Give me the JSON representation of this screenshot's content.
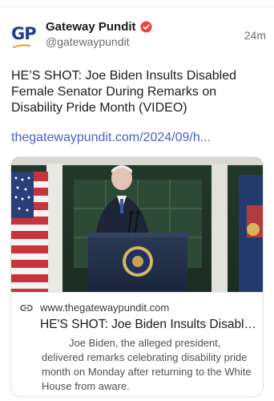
{
  "account": {
    "logo_text": "GP",
    "name": "Gateway Pundit",
    "handle": "@gatewaypundit",
    "time": "24m"
  },
  "post": {
    "text": "HE’S SHOT: Joe Biden Insults Disabled Female Senator During Remarks on Disability Pride Month (VIDEO)",
    "link": "thegatewaypundit.com/2024/09/h..."
  },
  "card": {
    "domain": "www.thegatewaypundit.com",
    "title": "HE'S SHOT: Joe Biden Insults Disable...",
    "description": "Joe Biden, the alleged president, delivered remarks celebrating disability pride month on Monday after returning to the White House from aware."
  },
  "icons": {
    "verified": "verified-badge-icon",
    "link": "link-chain-icon"
  },
  "colors": {
    "brand_blue": "#1f3e8c",
    "brand_orange": "#f29b21",
    "verified_red": "#e8453c",
    "link_blue": "#4a62c7"
  }
}
